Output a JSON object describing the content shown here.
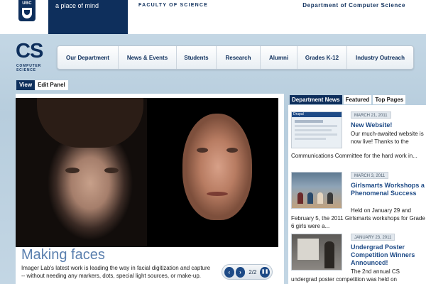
{
  "header": {
    "ubc_logo": "UBC",
    "tagline": "a place of mind",
    "faculty": "FACULTY OF SCIENCE",
    "department": "Department of Computer Science"
  },
  "logo": {
    "letters": "CS",
    "line1": "COMPUTER",
    "line2": "SCIENCE"
  },
  "nav": {
    "items": [
      {
        "label": "Our Department"
      },
      {
        "label": "News & Events"
      },
      {
        "label": "Students"
      },
      {
        "label": "Research"
      },
      {
        "label": "Alumni"
      },
      {
        "label": "Grades K-12"
      },
      {
        "label": "Industry Outreach"
      }
    ]
  },
  "view_tabs": {
    "view": "View",
    "edit_panel": "Edit Panel"
  },
  "feature": {
    "title": "Making faces",
    "description": "Imager Lab's latest work is leading the way in facial digitization and capture -- without needing any markers, dots, special light sources, or make-up.",
    "prev_icon": "chevron-left",
    "next_icon": "chevron-right",
    "pause_icon": "pause",
    "counter": "2/2",
    "prev_glyph": "‹",
    "next_glyph": "›",
    "pause_glyph": "❚❚"
  },
  "news_tabs": {
    "department_news": "Department News",
    "featured": "Featured",
    "top_pages": "Top Pages"
  },
  "news": [
    {
      "date": "MARCH 21, 2011",
      "title": "New Website!",
      "text_short": "Our much-awaited website is now live! Thanks to the",
      "text_full": "Communications Committee for the hard work in...",
      "thumb_label": "Drupal"
    },
    {
      "date": "MARCH 3, 2011",
      "title": "Girlsmarts Workshops a Phenomenal Success",
      "text_short": "Held on January 29 and",
      "text_full": "February 5, the 2011 Girlsmarts workshops for Grade 6 girls were a..."
    },
    {
      "date": "JANUARY 23, 2011",
      "title": "Undergrad Poster Competition Winners Announced!",
      "text_short": "The 2nd annual CS",
      "text_full": "undergrad poster competition was held on"
    }
  ],
  "colors": {
    "brand_navy": "#0e2f5c",
    "link_blue": "#1d4a86",
    "feature_title": "#5a7fae",
    "background": "#c9dbe8"
  }
}
